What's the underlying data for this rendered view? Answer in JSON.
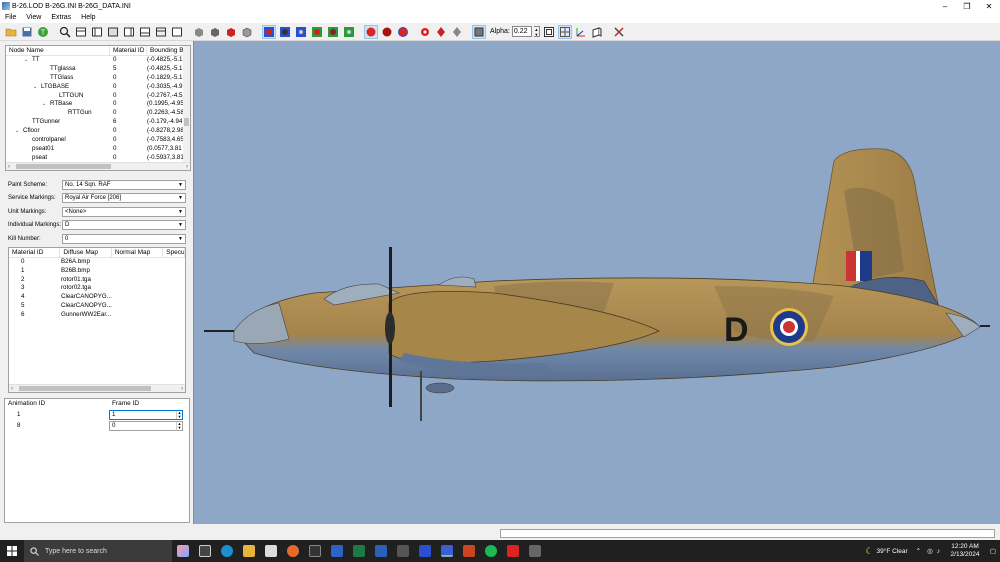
{
  "window": {
    "title": "B-26.LOD  B-26G.INI  B-26G_DATA.INI"
  },
  "menu": [
    "File",
    "View",
    "Extras",
    "Help"
  ],
  "toolbar": {
    "alpha_label": "Alpha:",
    "alpha_value": "0.22"
  },
  "tree": {
    "headers": [
      "Node Name",
      "Material ID",
      "Bounding B"
    ],
    "rows": [
      {
        "indent": 2,
        "expander": "v",
        "name": "TT",
        "mat": "0",
        "bb": "(-0.4825,-5.1"
      },
      {
        "indent": 4,
        "expander": "",
        "name": "TTglassa",
        "mat": "5",
        "bb": "(-0.4825,-5.1"
      },
      {
        "indent": 4,
        "expander": "",
        "name": "TTGlass",
        "mat": "0",
        "bb": "(-0.1829,-5.1"
      },
      {
        "indent": 3,
        "expander": "v",
        "name": "LTGBASE",
        "mat": "0",
        "bb": "(-0.3035,-4.9"
      },
      {
        "indent": 5,
        "expander": "",
        "name": "LTTGUN",
        "mat": "0",
        "bb": "(-0.2767,-4.5"
      },
      {
        "indent": 4,
        "expander": "v",
        "name": "RTBase",
        "mat": "0",
        "bb": "(0.1995,-4.95"
      },
      {
        "indent": 6,
        "expander": "",
        "name": "RTTGun",
        "mat": "0",
        "bb": "(0.2263,-4.58"
      },
      {
        "indent": 2,
        "expander": "",
        "name": "TTGunner",
        "mat": "6",
        "bb": "(-0.179,-4.94"
      },
      {
        "indent": 1,
        "expander": "v",
        "name": "Cfloor",
        "mat": "0",
        "bb": "(-0.8278,2.98"
      },
      {
        "indent": 2,
        "expander": "",
        "name": "controlpanel",
        "mat": "0",
        "bb": "(-0.7583,4.65"
      },
      {
        "indent": 2,
        "expander": "",
        "name": "pseat01",
        "mat": "0",
        "bb": "(0.0577,3.81"
      },
      {
        "indent": 2,
        "expander": "",
        "name": "pseat",
        "mat": "0",
        "bb": "(-0.5937,3.81"
      }
    ]
  },
  "properties": [
    {
      "label": "Paint Scheme:",
      "value": "No. 14 Sqn. RAF"
    },
    {
      "label": "Service Markings:",
      "value": "Royal Air Force [206]"
    },
    {
      "label": "Unit Markings:",
      "value": "<None>"
    },
    {
      "label": "Individual Markings:",
      "value": "D"
    },
    {
      "label": "Kill Number:",
      "value": "0"
    }
  ],
  "materials": {
    "headers": [
      "Material ID",
      "Diffuse Map",
      "Normal Map",
      "Specu"
    ],
    "rows": [
      {
        "id": "0",
        "diffuse": "B26A.bmp"
      },
      {
        "id": "1",
        "diffuse": "B26B.bmp"
      },
      {
        "id": "2",
        "diffuse": "rotor01.tga"
      },
      {
        "id": "3",
        "diffuse": "rotor02.tga"
      },
      {
        "id": "4",
        "diffuse": "ClearCANOPYG..."
      },
      {
        "id": "5",
        "diffuse": "ClearCANOPYG..."
      },
      {
        "id": "6",
        "diffuse": "GunnerWW2Ear..."
      }
    ]
  },
  "animation": {
    "headers": [
      "Animation ID",
      "Frame ID"
    ],
    "rows": [
      {
        "id": "1",
        "frame": "1"
      },
      {
        "id": "8",
        "frame": "0"
      }
    ]
  },
  "aircraft": {
    "code_letter": "D"
  },
  "taskbar": {
    "search_placeholder": "Type here to search",
    "weather": "39°F  Clear",
    "time": "12:20 AM",
    "date": "2/13/2024"
  },
  "colors": {
    "viewport": "#8fa7c7",
    "camo_sand": "#b08f55",
    "camo_underside": "#6b85a8",
    "taskbar": "#202020"
  }
}
